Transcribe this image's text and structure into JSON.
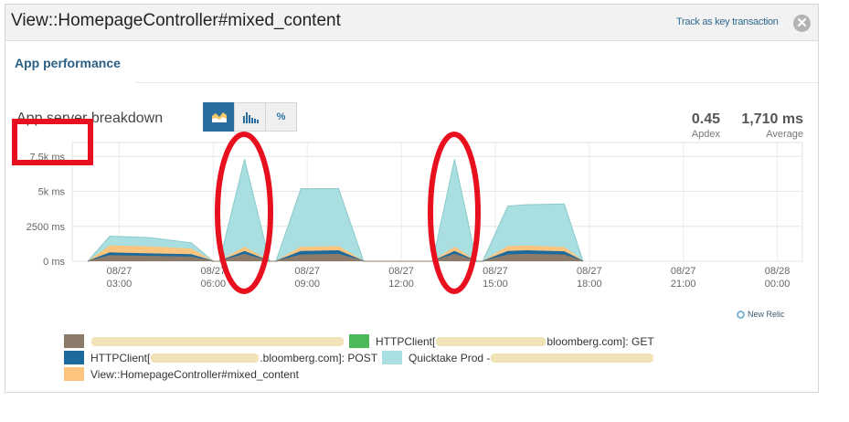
{
  "header": {
    "title": "View::HomepageController#mixed_content",
    "key_transaction_link": "Track as key transaction",
    "close_glyph": "✕"
  },
  "tabs": [
    {
      "label": "App performance",
      "active": true
    }
  ],
  "chart_title": "App server breakdown",
  "view_buttons": [
    {
      "name": "area-chart-icon",
      "label": "",
      "active": true
    },
    {
      "name": "histogram-icon",
      "label": "",
      "active": false
    },
    {
      "name": "percent-button",
      "label": "%",
      "active": false
    }
  ],
  "metrics": {
    "apdex": {
      "value": "0.45",
      "label": "Apdex"
    },
    "average": {
      "value": "1,710 ms",
      "label": "Average"
    }
  },
  "branding": {
    "label": "New Relic"
  },
  "colors": {
    "brown": "#8c7b6b",
    "green": "#4cb85a",
    "blue": "#1d6a9c",
    "teal": "#a9dfe0",
    "orange": "#fcc57f",
    "annotation_red": "#e8101e",
    "active_button": "#2a6ea0"
  },
  "legend": [
    {
      "name": "legend-item-1",
      "color": "brown",
      "label": "",
      "redacted_prefix": true
    },
    {
      "name": "legend-item-2",
      "color": "green",
      "label_prefix": "HTTPClient[",
      "label_suffix": "bloomberg.com]: GET"
    },
    {
      "name": "legend-item-3",
      "color": "blue",
      "label_prefix": "HTTPClient[",
      "label_suffix": ".bloomberg.com]: POST"
    },
    {
      "name": "legend-item-4",
      "color": "teal",
      "label_prefix": "Quicktake Prod - ",
      "label_suffix": ""
    },
    {
      "name": "legend-item-5",
      "color": "orange",
      "label_prefix": "View::HomepageController#mixed_content",
      "label_suffix": ""
    }
  ],
  "chart_data": {
    "type": "area",
    "stacked": true,
    "title": "App server breakdown",
    "ylabel": "",
    "y_unit": "ms",
    "ylim": [
      0,
      8500
    ],
    "y_ticks": [
      {
        "value": 0,
        "label": "0 ms"
      },
      {
        "value": 2500,
        "label": "2500 ms"
      },
      {
        "value": 5000,
        "label": "5k ms"
      },
      {
        "value": 7500,
        "label": "7.5k ms"
      }
    ],
    "x_range_hours": [
      1.5,
      24.8
    ],
    "x_ticks": [
      {
        "h": 3,
        "date": "08/27",
        "time": "03:00"
      },
      {
        "h": 6,
        "date": "08/27",
        "time": "06:00"
      },
      {
        "h": 9,
        "date": "08/27",
        "time": "09:00"
      },
      {
        "h": 12,
        "date": "08/27",
        "time": "12:00"
      },
      {
        "h": 15,
        "date": "08/27",
        "time": "15:00"
      },
      {
        "h": 18,
        "date": "08/27",
        "time": "18:00"
      },
      {
        "h": 21,
        "date": "08/27",
        "time": "21:00"
      },
      {
        "h": 24,
        "date": "08/28",
        "time": "00:00"
      }
    ],
    "x_hours": [
      2.0,
      2.7,
      4.0,
      5.3,
      6.0,
      6.2,
      7.0,
      7.8,
      8.0,
      8.8,
      10.0,
      10.8,
      11.0,
      12.8,
      13.0,
      13.7,
      14.4,
      14.6,
      15.4,
      16.0,
      17.2,
      17.8
    ],
    "series": [
      {
        "name": "",
        "color": "brown",
        "values": [
          0,
          400,
          350,
          300,
          0,
          0,
          500,
          0,
          0,
          450,
          500,
          0,
          0,
          0,
          0,
          500,
          0,
          0,
          450,
          500,
          450,
          0
        ]
      },
      {
        "name": "",
        "color": "blue",
        "values": [
          0,
          200,
          180,
          170,
          0,
          0,
          200,
          0,
          0,
          250,
          250,
          0,
          0,
          0,
          0,
          200,
          0,
          0,
          250,
          250,
          230,
          0
        ]
      },
      {
        "name": "",
        "color": "orange",
        "values": [
          0,
          500,
          500,
          400,
          0,
          0,
          300,
          0,
          0,
          300,
          300,
          0,
          0,
          0,
          0,
          300,
          0,
          0,
          350,
          350,
          300,
          0
        ]
      },
      {
        "name": "",
        "color": "teal",
        "values": [
          0,
          700,
          650,
          450,
          0,
          0,
          6300,
          0,
          0,
          4200,
          4150,
          0,
          0,
          0,
          0,
          6300,
          0,
          0,
          2900,
          2950,
          3120,
          0
        ]
      }
    ]
  },
  "annotations": {
    "red_box_note": "highlight y max",
    "red_ellipses": 2
  }
}
